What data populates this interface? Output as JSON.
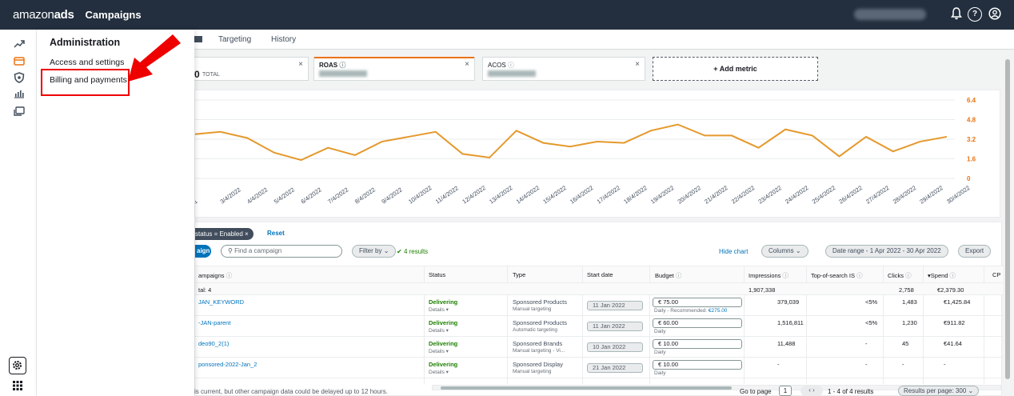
{
  "topbar": {
    "logo_text": "amazon",
    "logo_bold": "ads",
    "app_title": "Campaigns",
    "icons": [
      "bell-icon",
      "help-icon",
      "account-icon"
    ]
  },
  "menu": {
    "heading": "Administration",
    "items": [
      {
        "label": "Access and settings"
      },
      {
        "label": "Billing and payments"
      }
    ]
  },
  "tabs": [
    {
      "label": "Targeting"
    },
    {
      "label": "History"
    }
  ],
  "metrics": [
    {
      "name": "",
      "value": "0",
      "suffix": "TOTAL"
    },
    {
      "name": "ROAS",
      "selected": true
    },
    {
      "name": "ACOS"
    }
  ],
  "add_metric_label": "+ Add metric",
  "chart_data": {
    "type": "line",
    "x": [
      "3/4/2022",
      "4/4/2022",
      "5/4/2022",
      "6/4/2022",
      "7/4/2022",
      "8/4/2022",
      "9/4/2022",
      "10/4/2022",
      "11/4/2022",
      "12/4/2022",
      "13/4/2022",
      "14/4/2022",
      "15/4/2022",
      "16/4/2022",
      "17/4/2022",
      "18/4/2022",
      "19/4/2022",
      "20/4/2022",
      "21/4/2022",
      "22/4/2022",
      "23/4/2022",
      "24/4/2022",
      "25/4/2022",
      "26/4/2022",
      "27/4/2022",
      "28/4/2022",
      "29/4/2022",
      "30/4/2022"
    ],
    "x_labels": [
      "1",
      "3/4/2022",
      "4/4/2022",
      "5/4/2022",
      "6/4/2022",
      "7/4/2022",
      "8/4/2022",
      "9/4/2022",
      "10/4/2022",
      "11/4/2022",
      "12/4/2022",
      "13/4/2022",
      "14/4/2022",
      "15/4/2022",
      "16/4/2022",
      "17/4/2022",
      "18/4/2022",
      "19/4/2022",
      "20/4/2022",
      "21/4/2022",
      "22/4/2022",
      "23/4/2022",
      "24/4/2022",
      "25/4/2022",
      "26/4/2022",
      "27/4/2022",
      "28/4/2022",
      "29/4/2022",
      "30/4/2022"
    ],
    "values": [
      3.6,
      3.8,
      3.3,
      2.1,
      1.5,
      2.5,
      1.9,
      3.0,
      3.4,
      3.8,
      2.0,
      1.7,
      3.9,
      2.9,
      2.6,
      3.0,
      2.9,
      3.9,
      4.4,
      3.5,
      3.5,
      2.5,
      4.0,
      3.5,
      1.8,
      3.4,
      2.2,
      3.0,
      3.4
    ],
    "y_ticks": [
      "6.4",
      "4.8",
      "3.2",
      "1.6",
      "0"
    ],
    "ylim": [
      0,
      6.4
    ],
    "color": "#e5992c"
  },
  "filters": {
    "chip_label": "status = Enabled ×",
    "reset_label": "Reset",
    "create_label": "aign",
    "search_placeholder": "Find a campaign",
    "filter_by_label": "Filter by",
    "results_label": "4 results",
    "hide_chart_label": "Hide chart",
    "columns_label": "Columns",
    "date_range_label": "Date range - 1 Apr 2022 - 30 Apr 2022",
    "export_label": "Export"
  },
  "table": {
    "headers": {
      "campaigns": "ampaigns",
      "status": "Status",
      "type": "Type",
      "start_date": "Start date",
      "budget": "Budget",
      "impressions": "Impressions",
      "top_of_search": "Top-of-search IS",
      "clicks": "Clicks",
      "spend": "Spend",
      "cpc": "CP"
    },
    "total": {
      "label": "tal: 4",
      "impressions": "1,907,338",
      "clicks": "2,758",
      "spend": "€2,379.30"
    },
    "rows": [
      {
        "name": "JAN_KEYWORD",
        "status": "Delivering",
        "details": "Details",
        "type": "Sponsored Products",
        "targeting": "Manual targeting",
        "start": "11 Jan 2022",
        "budget": "€  75.00",
        "budget_note_prefix": "Daily - Recommended: ",
        "budget_note_link": "€275.00",
        "impressions": "379,039",
        "tos": "<5%",
        "clicks": "1,483",
        "spend": "€1,425.84"
      },
      {
        "name": "-JAN-parent",
        "status": "Delivering",
        "details": "Details",
        "type": "Sponsored Products",
        "targeting": "Automatic targeting",
        "start": "11 Jan 2022",
        "budget": "€  60.00",
        "budget_note_prefix": "Daily",
        "budget_note_link": "",
        "impressions": "1,516,811",
        "tos": "<5%",
        "clicks": "1,230",
        "spend": "€911.82"
      },
      {
        "name": "deo90_2(1)",
        "status": "Delivering",
        "details": "Details",
        "type": "Sponsored Brands",
        "targeting": "Manual targeting - Vi...",
        "start": "10 Jan 2022",
        "budget": "€  10.00",
        "budget_note_prefix": "Daily",
        "budget_note_link": "",
        "impressions": "11,488",
        "tos": "-",
        "clicks": "45",
        "spend": "€41.64"
      },
      {
        "name": "ponsored-2022-Jan_2",
        "status": "Delivering",
        "details": "Details",
        "type": "Sponsored Display",
        "targeting": "Manual targeting",
        "start": "21 Jan 2022",
        "budget": "€  10.00",
        "budget_note_prefix": "Daily",
        "budget_note_link": "",
        "impressions": "-",
        "tos": "-",
        "clicks": "-",
        "spend": "-"
      }
    ]
  },
  "footer": {
    "notice": "is current, but other campaign data could be delayed up to 12 hours.",
    "go_to_page_label": "Go to page",
    "page_value": "1",
    "range_label": "1 - 4 of 4 results",
    "per_page_label": "Results per page: 300"
  }
}
